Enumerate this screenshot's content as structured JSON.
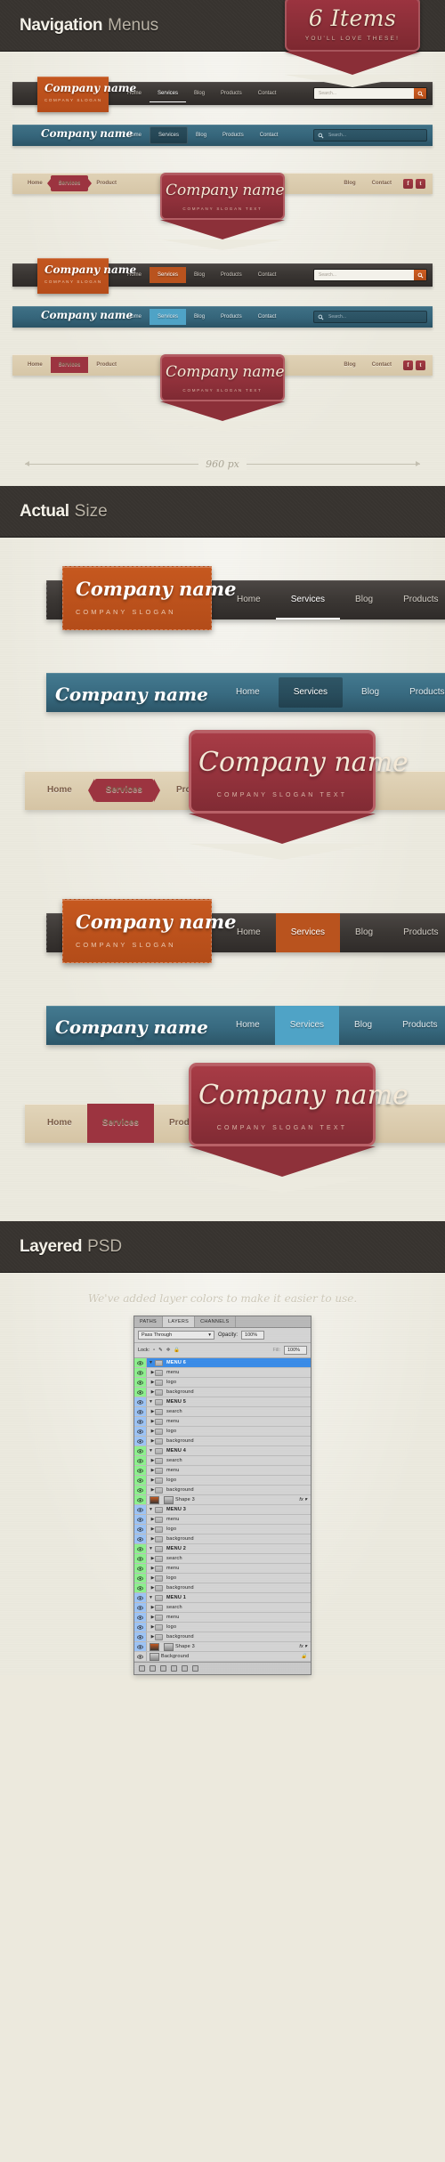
{
  "sections": [
    {
      "title_bold": "Navigation",
      "title_light": "Menus"
    },
    {
      "title_bold": "Actual",
      "title_light": "Size"
    },
    {
      "title_bold": "Layered",
      "title_light": "PSD"
    }
  ],
  "ribbon": {
    "headline": "6 Items",
    "subline": "YOU'LL LOVE THESE!"
  },
  "brand": {
    "company_name": "Company name",
    "slogan_short": "COMPANY SLOGAN",
    "slogan_long": "COMPANY SLOGAN TEXT"
  },
  "search": {
    "placeholder": "Search...",
    "icon": "magnifier-icon"
  },
  "social": [
    {
      "name": "facebook-icon",
      "glyph": "f"
    },
    {
      "name": "twitter-icon",
      "glyph": "t"
    }
  ],
  "menus": {
    "standard_links": [
      "Home",
      "Services",
      "Blog",
      "Products",
      "Contact"
    ],
    "split_left": [
      "Home",
      "Services",
      "Product"
    ],
    "split_right": [
      "Blog",
      "Contact"
    ],
    "active": "Services"
  },
  "measurement": {
    "label": "960 px"
  },
  "psd": {
    "note": "We've added layer colors to make it easier to use.",
    "tabs": [
      "PATHS",
      "LAYERS",
      "CHANNELS"
    ],
    "active_tab": "LAYERS",
    "blend_mode": "Pass Through",
    "opacity_label": "Opacity:",
    "opacity_value": "100%",
    "lock_label": "Lock:",
    "fill_label": "Fill:",
    "fill_value": "100%",
    "fx_label": "fx",
    "background_layer": "Background",
    "groups": [
      {
        "name": "MENU 6",
        "color": "green",
        "selected": true,
        "children": [
          "menu",
          "logo",
          "background"
        ],
        "shape": null
      },
      {
        "name": "MENU 5",
        "color": "blue",
        "selected": false,
        "children": [
          "search",
          "menu",
          "logo",
          "background"
        ],
        "shape": null
      },
      {
        "name": "MENU 4",
        "color": "green",
        "selected": false,
        "children": [
          "search",
          "menu",
          "logo",
          "background"
        ],
        "shape": "Shape 3"
      },
      {
        "name": "MENU 3",
        "color": "blue",
        "selected": false,
        "children": [
          "menu",
          "logo",
          "background"
        ],
        "shape": null
      },
      {
        "name": "MENU 2",
        "color": "green",
        "selected": false,
        "children": [
          "search",
          "menu",
          "logo",
          "background"
        ],
        "shape": null
      },
      {
        "name": "MENU 1",
        "color": "blue",
        "selected": false,
        "children": [
          "search",
          "menu",
          "logo",
          "background"
        ],
        "shape": "Shape 3"
      }
    ]
  },
  "colors": {
    "dark_bar": "#37332f",
    "page_bg": "#eceadf",
    "orange": "#c4561f",
    "blue": "#35657a",
    "red": "#93323c",
    "beige": "#d6c6a7"
  }
}
